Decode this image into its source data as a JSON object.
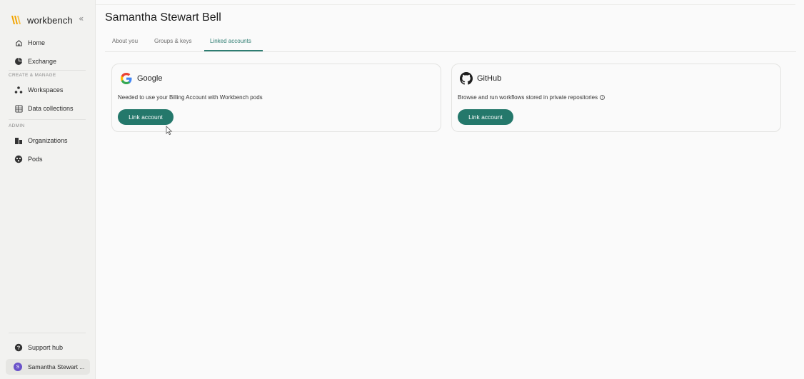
{
  "app": {
    "name": "workbench",
    "collapse_icon": "double-chevron-left-icon"
  },
  "sidebar": {
    "items": [
      {
        "label": "Home",
        "icon": "home-icon"
      },
      {
        "label": "Exchange",
        "icon": "exchange-icon"
      },
      {
        "label": "Workspaces",
        "icon": "workspaces-icon"
      },
      {
        "label": "Data collections",
        "icon": "data-collections-icon"
      },
      {
        "label": "Organizations",
        "icon": "organizations-icon"
      },
      {
        "label": "Pods",
        "icon": "pods-icon"
      }
    ],
    "sections": {
      "create_manage": "CREATE & MANAGE",
      "admin": "ADMIN"
    },
    "support": {
      "label": "Support hub",
      "icon": "help-icon"
    },
    "user": {
      "initial": "S",
      "label": "Samantha Stewart ..."
    }
  },
  "page": {
    "title": "Samantha Stewart Bell",
    "tabs": [
      {
        "label": "About you",
        "active": false
      },
      {
        "label": "Groups & keys",
        "active": false
      },
      {
        "label": "Linked accounts",
        "active": true
      }
    ]
  },
  "cards": [
    {
      "name": "Google",
      "icon": "google-icon",
      "description": "Needed to use your Billing Account with Workbench pods",
      "button": "Link account"
    },
    {
      "name": "GitHub",
      "icon": "github-icon",
      "description": "Browse and run workflows stored in private repositories",
      "info_icon": "info-icon",
      "button": "Link account"
    }
  ],
  "colors": {
    "accent": "#24786b",
    "avatar": "#6a52c9",
    "brand": "#f2a400"
  }
}
